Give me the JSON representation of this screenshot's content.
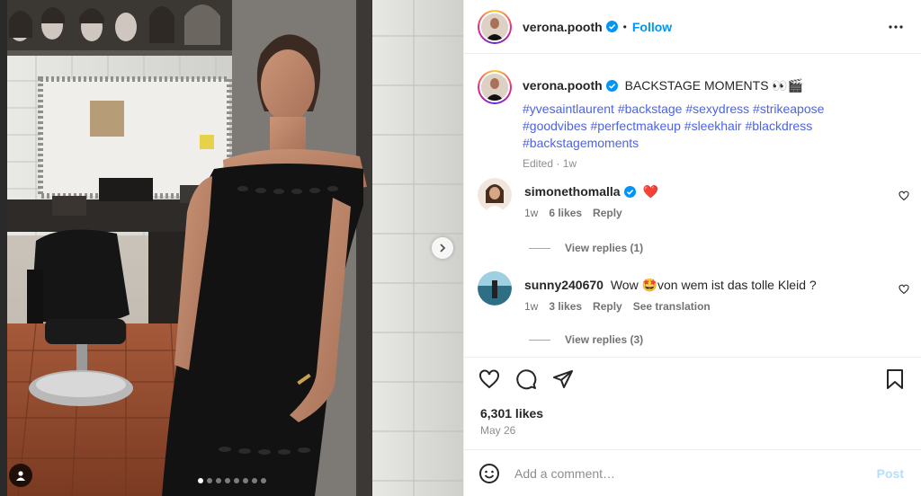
{
  "post": {
    "author": "verona.pooth",
    "follow_label": "Follow",
    "separator": "•",
    "caption_title": "BACKSTAGE MOMENTS 👀🎬",
    "hashtags": "#yvesaintlaurent #backstage #sexydress #strikeapose #goodvibes #perfectmakeup #sleekhair #blackdress #backstagemoments",
    "edited": "Edited · 1w",
    "likes": "6,301 likes",
    "date": "May 26",
    "carousel": {
      "count": 8,
      "active": 1
    }
  },
  "comments": [
    {
      "user": "simonethomalla",
      "text": "❤️",
      "time": "1w",
      "likes": "6 likes",
      "reply": "Reply",
      "translate": "",
      "view_replies": "View replies (1)"
    },
    {
      "user": "sunny240670",
      "text": "Wow 🤩von wem ist das tolle Kleid ?",
      "time": "1w",
      "likes": "3 likes",
      "reply": "Reply",
      "translate": "See translation",
      "view_replies": "View replies (3)"
    }
  ],
  "composer": {
    "placeholder": "Add a comment…",
    "post_label": "Post"
  },
  "icons": {
    "verified": "verified-badge-icon",
    "more": "more-options-icon",
    "like": "heart-icon",
    "comment": "comment-icon",
    "share": "share-icon",
    "save": "bookmark-icon",
    "emoji": "emoji-icon",
    "next": "chevron-right-icon",
    "tag": "user-tag-icon"
  },
  "colors": {
    "accent": "#0095f6",
    "hashtag": "#4c63e8",
    "muted": "#8e8e8e",
    "verified": "#0095f6"
  }
}
